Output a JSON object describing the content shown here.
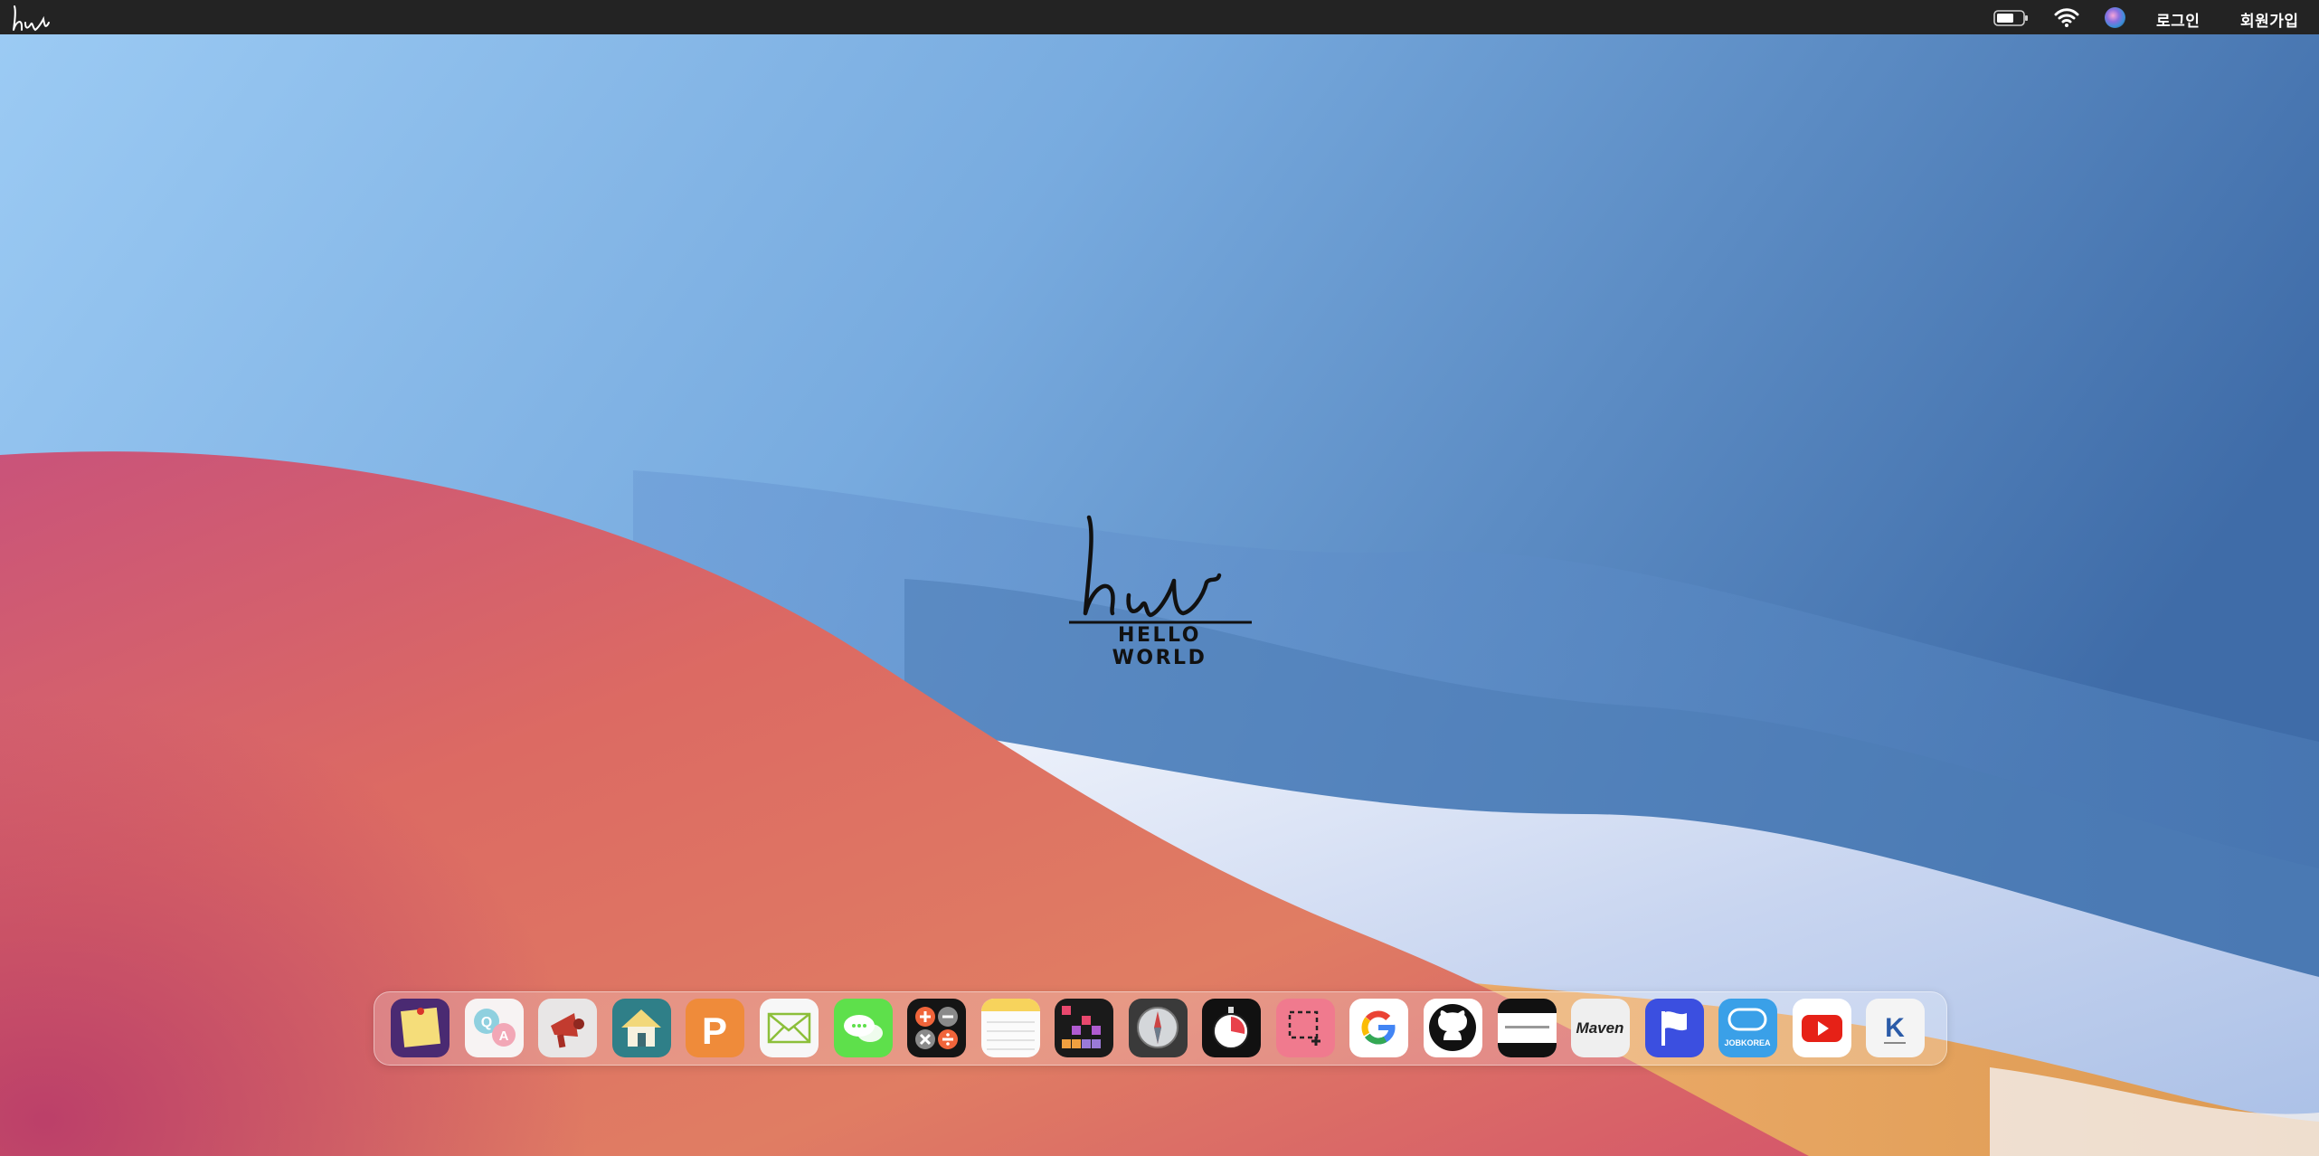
{
  "menubar": {
    "logo_text": "hw",
    "login_label": "로그인",
    "signup_label": "회원가입"
  },
  "center": {
    "logo_text": "hw",
    "tagline": "HELLO WORLD"
  },
  "dock": {
    "apps": [
      {
        "id": "sticky-notes",
        "label": "Sticky notes"
      },
      {
        "id": "qna",
        "label": "Q A",
        "text": "Q A"
      },
      {
        "id": "announcement",
        "label": "Announcement"
      },
      {
        "id": "home",
        "label": "Home"
      },
      {
        "id": "p-app",
        "label": "P",
        "text": "P"
      },
      {
        "id": "mail",
        "label": "Mail"
      },
      {
        "id": "messages",
        "label": "Messages"
      },
      {
        "id": "calculator",
        "label": "Calculator"
      },
      {
        "id": "notes",
        "label": "Notes"
      },
      {
        "id": "grid-app",
        "label": "Grid"
      },
      {
        "id": "compass",
        "label": "Compass"
      },
      {
        "id": "stopwatch",
        "label": "Stopwatch"
      },
      {
        "id": "screenshot",
        "label": "Screenshot"
      },
      {
        "id": "google",
        "label": "Google",
        "text": "G"
      },
      {
        "id": "github",
        "label": "GitHub"
      },
      {
        "id": "dark-site",
        "label": "Site"
      },
      {
        "id": "maven",
        "label": "Maven",
        "text": "Maven"
      },
      {
        "id": "flag-app",
        "label": "Flag"
      },
      {
        "id": "jobkorea",
        "label": "JOBKOREA",
        "text": "JOBKOREA"
      },
      {
        "id": "youtube",
        "label": "YouTube"
      },
      {
        "id": "k-app",
        "label": "K",
        "text": "K"
      }
    ]
  },
  "colors": {
    "menubar_bg": "#232323",
    "sky_light": "#9ccbf4",
    "sky_dark": "#3d6aa5",
    "red_wave": "#d2566a",
    "orange_sand": "#e6a65e"
  }
}
